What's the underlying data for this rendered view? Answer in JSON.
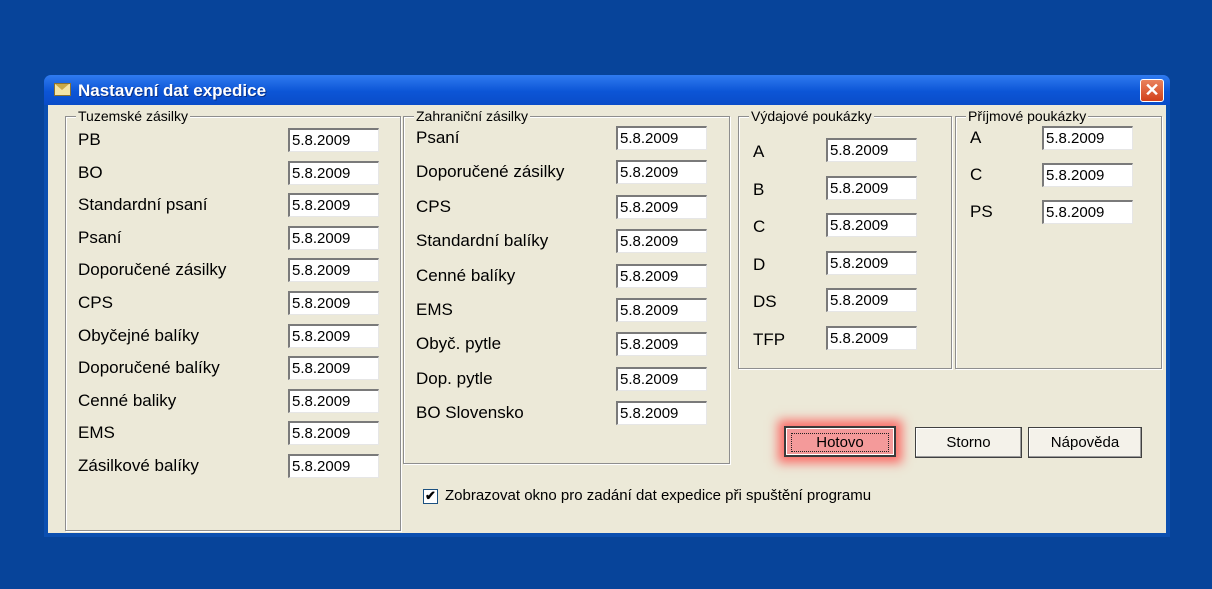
{
  "window": {
    "title": "Nastavení dat expedice",
    "close_glyph": "✕"
  },
  "groups": {
    "tuzemske": {
      "title": "Tuzemské zásilky",
      "rows": [
        {
          "label": "PB",
          "value": "5.8.2009"
        },
        {
          "label": "BO",
          "value": "5.8.2009"
        },
        {
          "label": "Standardní psaní",
          "value": "5.8.2009"
        },
        {
          "label": "Psaní",
          "value": "5.8.2009"
        },
        {
          "label": "Doporučené zásilky",
          "value": "5.8.2009"
        },
        {
          "label": "CPS",
          "value": "5.8.2009"
        },
        {
          "label": "Obyčejné balíky",
          "value": "5.8.2009"
        },
        {
          "label": "Doporučené balíky",
          "value": "5.8.2009"
        },
        {
          "label": "Cenné baliky",
          "value": "5.8.2009"
        },
        {
          "label": "EMS",
          "value": "5.8.2009"
        },
        {
          "label": "Zásilkové balíky",
          "value": "5.8.2009"
        }
      ]
    },
    "zahranicni": {
      "title": "Zahraniční zásilky",
      "rows": [
        {
          "label": "Psaní",
          "value": "5.8.2009"
        },
        {
          "label": "Doporučené zásilky",
          "value": "5.8.2009"
        },
        {
          "label": "CPS",
          "value": "5.8.2009"
        },
        {
          "label": "Standardní balíky",
          "value": "5.8.2009"
        },
        {
          "label": "Cenné balíky",
          "value": "5.8.2009"
        },
        {
          "label": "EMS",
          "value": "5.8.2009"
        },
        {
          "label": "Obyč. pytle",
          "value": "5.8.2009"
        },
        {
          "label": "Dop. pytle",
          "value": "5.8.2009"
        },
        {
          "label": "BO Slovensko",
          "value": "5.8.2009"
        }
      ]
    },
    "vydajove": {
      "title": "Výdajové poukázky",
      "rows": [
        {
          "label": "A",
          "value": "5.8.2009"
        },
        {
          "label": "B",
          "value": "5.8.2009"
        },
        {
          "label": "C",
          "value": "5.8.2009"
        },
        {
          "label": "D",
          "value": "5.8.2009"
        },
        {
          "label": "DS",
          "value": "5.8.2009"
        },
        {
          "label": "TFP",
          "value": "5.8.2009"
        }
      ]
    },
    "prijmove": {
      "title": "Příjmové poukázky",
      "rows": [
        {
          "label": "A",
          "value": "5.8.2009"
        },
        {
          "label": "C",
          "value": "5.8.2009"
        },
        {
          "label": "PS",
          "value": "5.8.2009"
        }
      ]
    }
  },
  "checkbox": {
    "label": "Zobrazovat okno pro zadání dat expedice při spuštění programu",
    "checked": true,
    "glyph": "✔"
  },
  "buttons": {
    "hotovo": "Hotovo",
    "storno": "Storno",
    "napoveda": "Nápověda"
  },
  "icons": {
    "title_icon": "envelope-icon",
    "close_icon": "close-icon"
  }
}
